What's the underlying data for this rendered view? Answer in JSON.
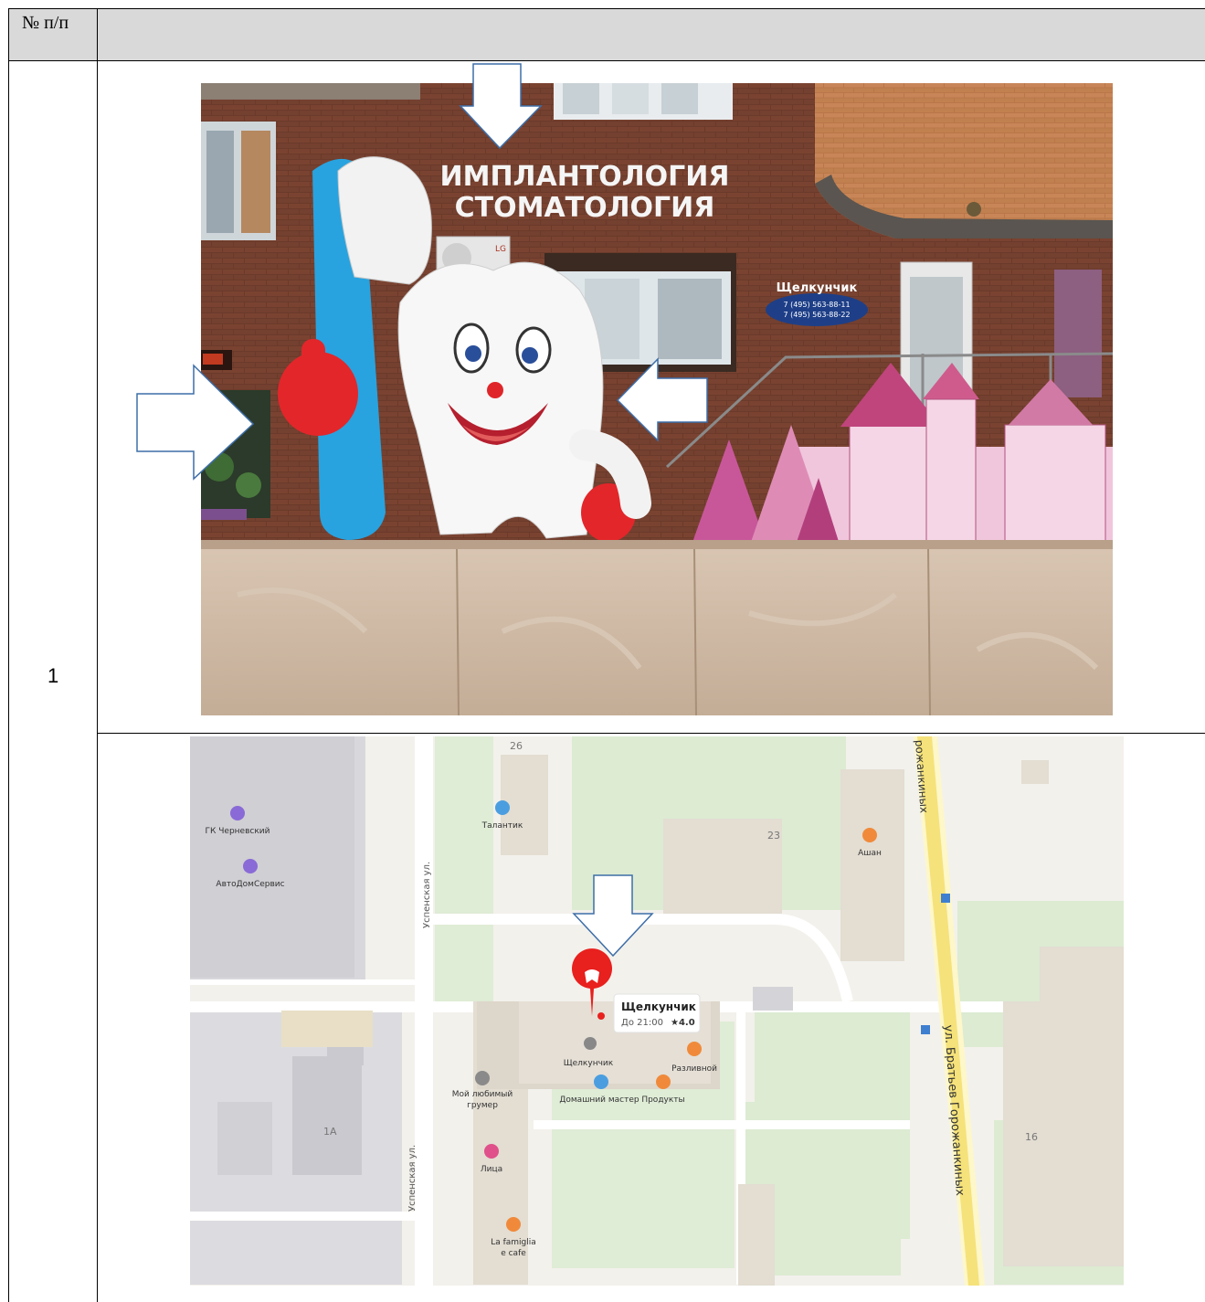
{
  "table": {
    "header": {
      "num_col": "№ п/п",
      "content_col": ""
    },
    "rows": [
      {
        "number": "1"
      }
    ]
  },
  "photo": {
    "sign_line1": "ИМПЛАНТОЛОГИЯ",
    "sign_line2": "СТОМАТОЛОГИЯ",
    "ac_brand": "LG",
    "plate_name": "Щелкунчик",
    "plate_phone1": "7 (495) 563-88-11",
    "plate_phone2": "7 (495) 563-88-22"
  },
  "map": {
    "streets": {
      "uspenskaya_top": "Успенская ул.",
      "uspenskaya_bottom": "Успенская ул.",
      "brothers_main": "ул. Братьев Горожанкиных",
      "brothers_top": "рожанкиных"
    },
    "house_numbers": {
      "h26": "26",
      "h23": "23",
      "h1a": "1А",
      "h16": "16"
    },
    "pois": {
      "chernevsky": "ГК Черневский",
      "avtodom": "АвтоДомСервис",
      "talantik": "Талантик",
      "ashan": "Ашан",
      "shchelkunchik": "Щелкунчик",
      "razlivnoy": "Разливной",
      "groomer1": "Мой любимый",
      "groomer2": "грумер",
      "master": "Домашний мастер",
      "produkty": "Продукты",
      "litsa": "Лица",
      "famiglia1": "La famiglia",
      "famiglia2": "e cafe"
    },
    "card": {
      "title": "Щелкунчик",
      "hours": "До 21:00",
      "rating": "★4.0"
    }
  },
  "colors": {
    "pin": "#e8201e",
    "arrow_stroke": "#3d6ea8"
  }
}
